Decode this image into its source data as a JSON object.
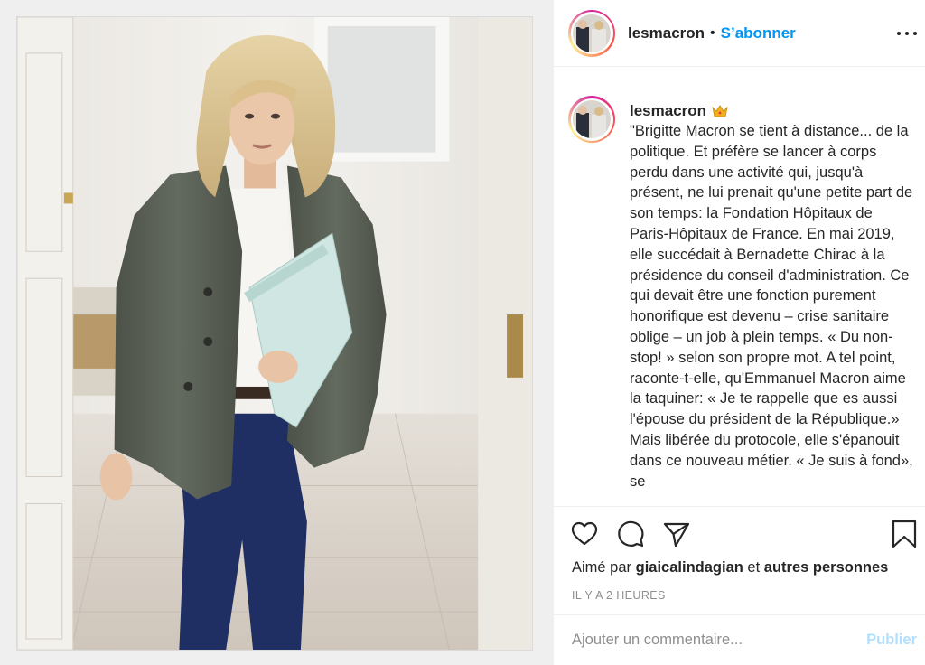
{
  "post": {
    "username": "lesmacron",
    "dot": "•",
    "follow_label": "S’abonner",
    "caption_username": "lesmacron",
    "caption_text": "\"Brigitte Macron se tient à distance... de la politique. Et préfère se lancer à corps perdu dans une activité qui, jusqu'à présent, ne lui prenait qu'une petite part de son temps: la Fondation Hôpitaux de Paris-Hôpitaux de France. En mai 2019, elle succédait à Bernadette Chirac à la présidence du conseil d'administration. Ce qui devait être une fonction purement honorifique est devenu – crise sanitaire oblige – un job à plein temps. « Du non-stop! » selon son propre mot. A tel point, raconte-t-elle, qu'Emmanuel Macron aime la taquiner: « Je te rappelle que es aussi l'épouse du président de la République.» Mais libérée du protocole, elle s'épanouit dans ce nouveau métier. « Je suis à fond», se"
  },
  "likes": {
    "prefix": "Aimé par",
    "user": "giaicalindagian",
    "conjunction": "et",
    "others": "autres personnes"
  },
  "timestamp": "IL Y A 2 HEURES",
  "comment": {
    "placeholder": "Ajouter un commentaire...",
    "publish_label": "Publier"
  },
  "icons": {
    "more": "more-horizontal-icon",
    "like": "heart-icon",
    "comment": "comment-bubble-icon",
    "share": "paper-plane-icon",
    "save": "bookmark-icon",
    "verified": "crown-icon"
  },
  "colors": {
    "link_blue": "#0095f6",
    "publish_disabled": "#b2dffc",
    "muted_text": "#8e8e8e",
    "border": "#efefef"
  }
}
